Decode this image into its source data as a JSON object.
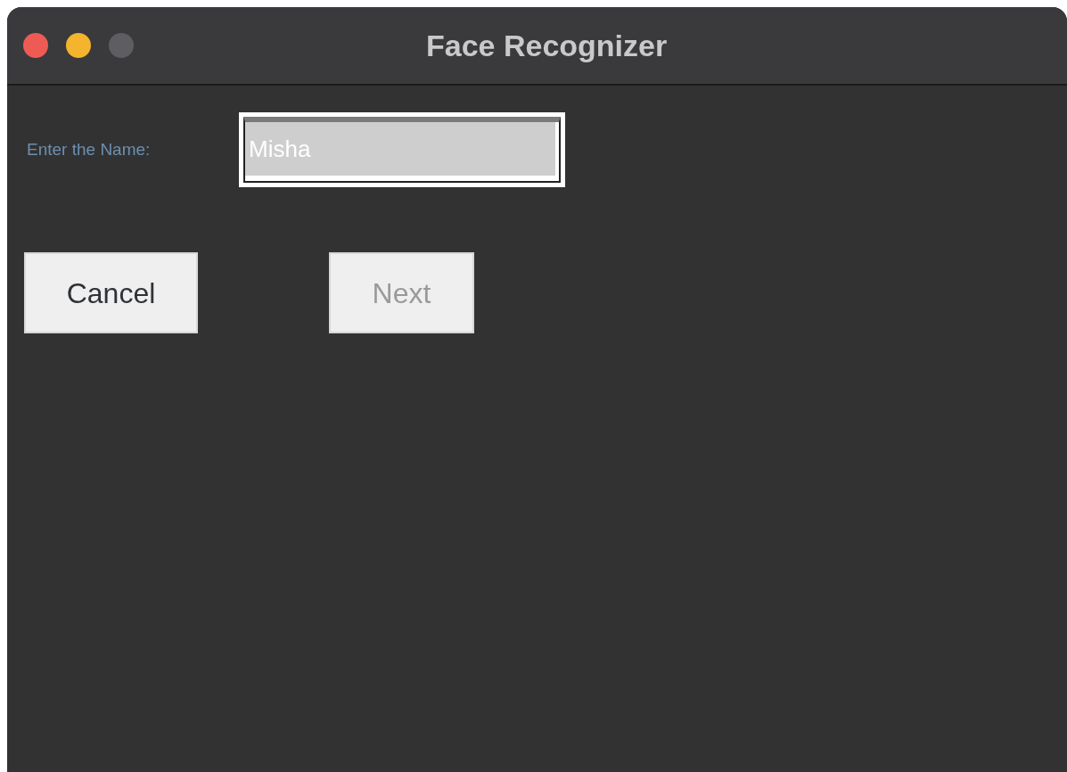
{
  "window": {
    "title": "Face Recognizer"
  },
  "form": {
    "label": "Enter the Name:",
    "field": {
      "value": "Misha"
    }
  },
  "buttons": [
    {
      "label": "Cancel",
      "disabled": false
    },
    {
      "label": "Next",
      "disabled": true
    }
  ]
}
